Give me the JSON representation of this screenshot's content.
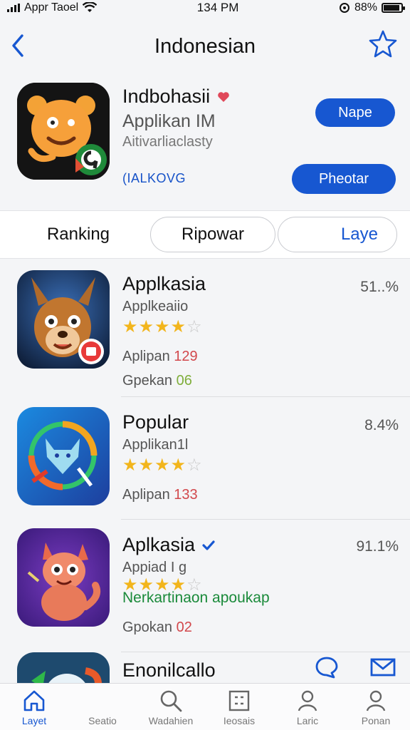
{
  "status": {
    "carrier": "Appr Taoel",
    "time": "134 PM",
    "battery": "88%"
  },
  "nav": {
    "title": "Indonesian"
  },
  "app": {
    "name": "Indbohasii",
    "subtitle": "Applikan IM",
    "category": "Aitivarliaclasty",
    "link": "(IALKOVG",
    "get_label": "Nape",
    "preorder_label": "Pheotar",
    "colors": {
      "accent": "#1757d1",
      "heart": "#e0485a"
    }
  },
  "tabs": [
    {
      "label": "Ranking",
      "active": false
    },
    {
      "label": "Ripowar",
      "active": true
    },
    {
      "label": "Laye",
      "active": false
    }
  ],
  "list": [
    {
      "name": "Applkasia",
      "subtitle": "Applkeaiio",
      "rating": 4,
      "meta1_label": "Aplipan",
      "meta1_value": "129",
      "meta2_label": "Gpekan",
      "meta2_value": "06",
      "percent": "51..%",
      "verified": false
    },
    {
      "name": "Popular",
      "subtitle": "Applikan1l",
      "rating": 4,
      "meta1_label": "Aplipan",
      "meta1_value": "133",
      "percent": "8.4%",
      "verified": false
    },
    {
      "name": "Aplkasia",
      "subtitle": "Appiad I g",
      "rating": 4,
      "overlay": "Nerkartinaon apoukap",
      "meta1_label": "Gpokan",
      "meta1_value": "02",
      "percent": "91.1%",
      "verified": true
    },
    {
      "name": "Enonilcallo"
    }
  ],
  "tabbar": [
    {
      "label": "Layet",
      "icon": "home-icon",
      "active": true
    },
    {
      "label": "Seatio",
      "icon": "search-icon",
      "active": false
    },
    {
      "label": "Wadahien",
      "icon": "search-icon",
      "active": false
    },
    {
      "label": "Ieosais",
      "icon": "grid-icon",
      "active": false
    },
    {
      "label": "Laric",
      "icon": "person-icon",
      "active": false
    },
    {
      "label": "Ponan",
      "icon": "person-icon",
      "active": false
    }
  ]
}
